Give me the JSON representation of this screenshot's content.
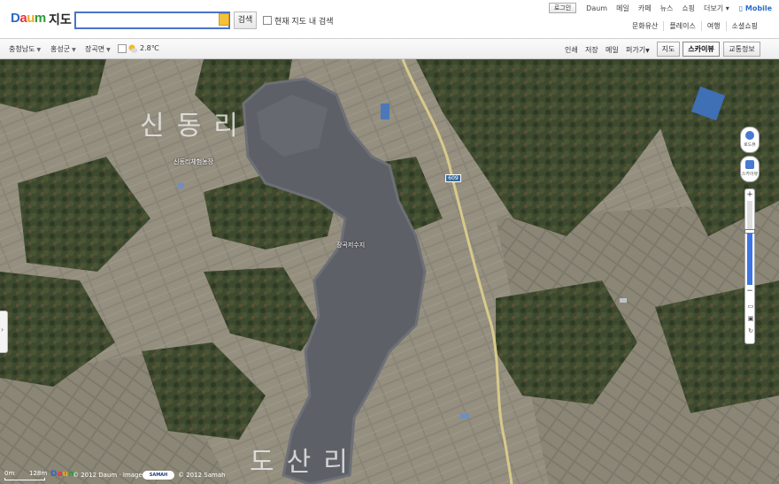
{
  "header": {
    "logo": {
      "d": "D",
      "a": "a",
      "u": "u",
      "m": "m",
      "title": "지도"
    },
    "search": {
      "value": "",
      "button": "검색",
      "within_label": "현재 지도 내 검색"
    },
    "util_links": [
      "Daum",
      "메일",
      "카페",
      "뉴스",
      "쇼핑",
      "더보기"
    ],
    "login_label": "로그인",
    "mobile_label": "Mobile",
    "services": [
      "문화유산",
      "플레이스",
      "여행",
      "소셜쇼핑"
    ]
  },
  "toolbar": {
    "regions": [
      "충청남도",
      "홍성군",
      "장곡면"
    ],
    "weather": {
      "temp": "2.8℃",
      "icon": "sun-cloud-icon"
    },
    "links": [
      "인쇄",
      "저장",
      "메일",
      "퍼가기"
    ],
    "tabs": [
      "지도",
      "스카이뷰",
      "교통정보"
    ],
    "active_tab": "스카이뷰"
  },
  "map": {
    "place_labels": [
      "신동리",
      "도산리"
    ],
    "poi_labels": [
      "신동리체험농장",
      "장곡저수지"
    ],
    "road_number": "609",
    "controls": {
      "roadview": "로드뷰",
      "skyview": "스카이뷰"
    },
    "zoom_level_fraction": 0.63
  },
  "footer": {
    "scale_zero": "0m",
    "scale_value": "128m",
    "copyright_daum": "© 2012 Daum · Imagery",
    "samah_badge": "SAMAH",
    "copyright_samah": "© 2012 Samah"
  },
  "colors": {
    "accent": "#3f74e3",
    "logo_d": "#2a6bcb",
    "logo_a": "#e8343a",
    "logo_u": "#f2a81c",
    "logo_m": "#2b9a3c"
  }
}
